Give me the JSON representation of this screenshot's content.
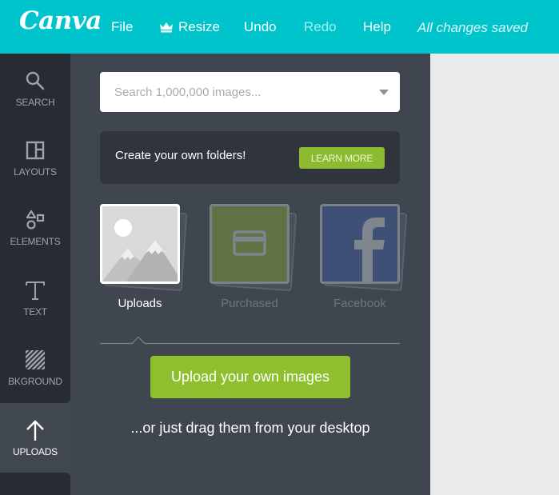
{
  "app": {
    "logo": "Canva"
  },
  "topbar": {
    "file": "File",
    "resize": "Resize",
    "undo": "Undo",
    "redo": "Redo",
    "help": "Help",
    "status": "All changes saved"
  },
  "sidebar": {
    "items": [
      {
        "label": "SEARCH",
        "icon": "search-icon"
      },
      {
        "label": "LAYOUTS",
        "icon": "layouts-icon"
      },
      {
        "label": "ELEMENTS",
        "icon": "elements-icon"
      },
      {
        "label": "TEXT",
        "icon": "text-icon"
      },
      {
        "label": "BKGROUND",
        "icon": "background-icon"
      },
      {
        "label": "UPLOADS",
        "icon": "upload-arrow-icon",
        "active": true
      }
    ]
  },
  "panel": {
    "search": {
      "placeholder": "Search 1,000,000 images...",
      "value": ""
    },
    "promo": {
      "text": "Create your own folders!",
      "button": "LEARN MORE"
    },
    "sources": [
      {
        "label": "Uploads",
        "icon": "image-placeholder-icon",
        "active": true
      },
      {
        "label": "Purchased",
        "icon": "credit-card-icon",
        "active": false
      },
      {
        "label": "Facebook",
        "icon": "facebook-icon",
        "active": false
      }
    ],
    "upload_button": "Upload your own images",
    "drag_hint": "...or just drag them from your desktop"
  },
  "colors": {
    "brand": "#00c4cc",
    "accent_green": "#8dbf2f",
    "sidebar_dark": "#272c34",
    "panel_bg": "#3f4650",
    "canvas_bg": "#e9eaeb"
  }
}
